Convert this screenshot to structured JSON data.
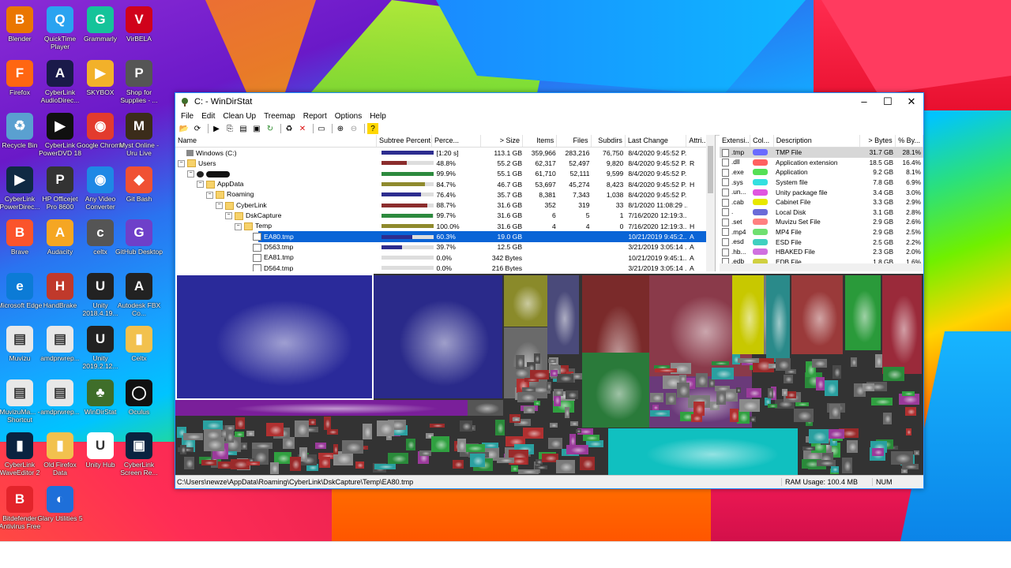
{
  "desktop": {
    "icons": [
      {
        "label": "Blender",
        "glyph": "B",
        "color": "#ea7600"
      },
      {
        "label": "QuickTime Player",
        "glyph": "Q",
        "color": "#2aa3f0"
      },
      {
        "label": "Grammarly",
        "glyph": "G",
        "color": "#15c39a"
      },
      {
        "label": "VirBELA",
        "glyph": "V",
        "color": "#d0021b"
      },
      {
        "label": "Firefox",
        "glyph": "F",
        "color": "#ff6611"
      },
      {
        "label": "CyberLink AudioDirec...",
        "glyph": "A",
        "color": "#1a1a4a"
      },
      {
        "label": "SKYBOX",
        "glyph": "▶",
        "color": "#f2b12a"
      },
      {
        "label": "Shop for Supplies - ...",
        "glyph": "P",
        "color": "#555555"
      },
      {
        "label": "Recycle Bin",
        "glyph": "♻",
        "color": "#5aa0d0"
      },
      {
        "label": "CyberLink PowerDVD 18",
        "glyph": "▶",
        "color": "#101010"
      },
      {
        "label": "Google Chrome",
        "glyph": "◉",
        "color": "#e33b2e"
      },
      {
        "label": "Myst Online - Uru Live",
        "glyph": "M",
        "color": "#3b2c1a"
      },
      {
        "label": "CyberLink PowerDirec...",
        "glyph": "▶",
        "color": "#0f2a44"
      },
      {
        "label": "HP Officejet Pro 8600",
        "glyph": "P",
        "color": "#333333"
      },
      {
        "label": "Any Video Converter",
        "glyph": "◉",
        "color": "#1e88e5"
      },
      {
        "label": "Git Bash",
        "glyph": "◆",
        "color": "#f05133"
      },
      {
        "label": "Brave",
        "glyph": "B",
        "color": "#fb542b"
      },
      {
        "label": "Audacity",
        "glyph": "A",
        "color": "#f5a623"
      },
      {
        "label": "celtx",
        "glyph": "c",
        "color": "#555555"
      },
      {
        "label": "GitHub Desktop",
        "glyph": "G",
        "color": "#6e40c9"
      },
      {
        "label": "Microsoft Edge",
        "glyph": "e",
        "color": "#0c7bd6"
      },
      {
        "label": "HandBrake",
        "glyph": "H",
        "color": "#c0392b"
      },
      {
        "label": "Unity 2018.4.19...",
        "glyph": "U",
        "color": "#222222"
      },
      {
        "label": "Autodesk FBX Co...",
        "glyph": "A",
        "color": "#222222"
      },
      {
        "label": "Muvizu",
        "glyph": "▤",
        "color": "#e8e8e8"
      },
      {
        "label": "amdprwrep...",
        "glyph": "▤",
        "color": "#e8e8e8"
      },
      {
        "label": "Unity 2019.2.12...",
        "glyph": "U",
        "color": "#222222"
      },
      {
        "label": "Celtx",
        "glyph": "▮",
        "color": "#f2c14e"
      },
      {
        "label": "MuvizuMa... - Shortcut",
        "glyph": "▤",
        "color": "#e8e8e8"
      },
      {
        "label": "amdprwrep...",
        "glyph": "▤",
        "color": "#e8e8e8"
      },
      {
        "label": "WinDirStat",
        "glyph": "♣",
        "color": "#3f6e2a"
      },
      {
        "label": "Oculus",
        "glyph": "◯",
        "color": "#111111"
      },
      {
        "label": "CyberLink WaveEditor 2",
        "glyph": "▮",
        "color": "#0a2340"
      },
      {
        "label": "Old Firefox Data",
        "glyph": "▮",
        "color": "#f2c14e"
      },
      {
        "label": "Unity Hub",
        "glyph": "U",
        "color": "#ffffff"
      },
      {
        "label": "CyberLink Screen Re...",
        "glyph": "▣",
        "color": "#0a2340"
      },
      {
        "label": "Bitdefender Antivirus Free",
        "glyph": "B",
        "color": "#e3242b"
      },
      {
        "label": "Glary Utilities 5",
        "glyph": "◐",
        "color": "#1e6fd9"
      }
    ]
  },
  "window": {
    "title": "C: - WinDirStat",
    "minimize": "–",
    "maximize": "☐",
    "close": "✕",
    "menus": [
      "File",
      "Edit",
      "Clean Up",
      "Treemap",
      "Report",
      "Options",
      "Help"
    ]
  },
  "tree": {
    "headers": {
      "name": "Name",
      "subtree": "Subtree Percent...",
      "perc": "Perce...",
      "size": "> Size",
      "items": "Items",
      "files": "Files",
      "subdirs": "Subdirs",
      "last": "Last Change",
      "attr": "Attri..."
    },
    "rows": [
      {
        "name": "Windows (C:)",
        "perc": "[1:20 s]",
        "size": "113.1 GB",
        "items": "359,966",
        "files": "283,216",
        "subdirs": "76,750",
        "last": "8/4/2020  9:45:52 P...",
        "attr": "",
        "bar": 1.0,
        "barColor": "#2d2d8f",
        "depth": 0,
        "icon": "drive",
        "exp": "",
        "sel": false
      },
      {
        "name": "Users",
        "perc": "48.8%",
        "size": "55.2 GB",
        "items": "62,317",
        "files": "52,497",
        "subdirs": "9,820",
        "last": "8/4/2020  9:45:52 P...",
        "attr": "R",
        "bar": 0.49,
        "barColor": "#8b2d2d",
        "depth": 0,
        "icon": "folder",
        "exp": "−",
        "sel": false
      },
      {
        "name": "",
        "perc": "99.9%",
        "size": "55.1 GB",
        "items": "61,710",
        "files": "52,111",
        "subdirs": "9,599",
        "last": "8/4/2020  9:45:52 P...",
        "attr": "",
        "bar": 0.999,
        "barColor": "#2d8a3e",
        "depth": 1,
        "icon": "user",
        "exp": "−",
        "sel": false
      },
      {
        "name": "AppData",
        "perc": "84.7%",
        "size": "46.7 GB",
        "items": "53,697",
        "files": "45,274",
        "subdirs": "8,423",
        "last": "8/4/2020  9:45:52 P...",
        "attr": "H",
        "bar": 0.847,
        "barColor": "#8f8a2d",
        "depth": 2,
        "icon": "folder",
        "exp": "−",
        "sel": false
      },
      {
        "name": "Roaming",
        "perc": "76.4%",
        "size": "35.7 GB",
        "items": "8,381",
        "files": "7,343",
        "subdirs": "1,038",
        "last": "8/4/2020  9:45:52 P...",
        "attr": "",
        "bar": 0.764,
        "barColor": "#2d2d8f",
        "depth": 3,
        "icon": "folder",
        "exp": "−",
        "sel": false
      },
      {
        "name": "CyberLink",
        "perc": "88.7%",
        "size": "31.6 GB",
        "items": "352",
        "files": "319",
        "subdirs": "33",
        "last": "8/1/2020  11:08:29 ...",
        "attr": "",
        "bar": 0.887,
        "barColor": "#8b2d2d",
        "depth": 4,
        "icon": "folder",
        "exp": "−",
        "sel": false
      },
      {
        "name": "DskCapture",
        "perc": "99.7%",
        "size": "31.6 GB",
        "items": "6",
        "files": "5",
        "subdirs": "1",
        "last": "7/16/2020  12:19:3...",
        "attr": "",
        "bar": 0.997,
        "barColor": "#2d8a3e",
        "depth": 5,
        "icon": "folder",
        "exp": "−",
        "sel": false
      },
      {
        "name": "Temp",
        "perc": "100.0%",
        "size": "31.6 GB",
        "items": "4",
        "files": "4",
        "subdirs": "0",
        "last": "7/16/2020  12:19:3...",
        "attr": "H",
        "bar": 1.0,
        "barColor": "#8f8a2d",
        "depth": 6,
        "icon": "folder",
        "exp": "−",
        "sel": false
      },
      {
        "name": "EA80.tmp",
        "perc": "60.3%",
        "size": "19.0 GB",
        "items": "",
        "files": "",
        "subdirs": "",
        "last": "10/21/2019  9:45:2...",
        "attr": "A",
        "bar": 0.603,
        "barColor": "#2d2d8f",
        "depth": 7,
        "icon": "file",
        "exp": "",
        "sel": true
      },
      {
        "name": "D563.tmp",
        "perc": "39.7%",
        "size": "12.5 GB",
        "items": "",
        "files": "",
        "subdirs": "",
        "last": "3/21/2019  3:05:14 ...",
        "attr": "A",
        "bar": 0.397,
        "barColor": "#2d2d8f",
        "depth": 7,
        "icon": "file",
        "exp": "",
        "sel": false
      },
      {
        "name": "EA81.tmp",
        "perc": "0.0%",
        "size": "342 Bytes",
        "items": "",
        "files": "",
        "subdirs": "",
        "last": "10/21/2019  9:45:1...",
        "attr": "A",
        "bar": 0.0,
        "barColor": "#2d2d8f",
        "depth": 7,
        "icon": "file",
        "exp": "",
        "sel": false
      },
      {
        "name": "D564.tmp",
        "perc": "0.0%",
        "size": "216 Bytes",
        "items": "",
        "files": "",
        "subdirs": "",
        "last": "3/21/2019  3:05:14 ...",
        "attr": "A",
        "bar": 0.0,
        "barColor": "#2d2d8f",
        "depth": 7,
        "icon": "file",
        "exp": "",
        "sel": false
      }
    ]
  },
  "ext": {
    "headers": {
      "ext": "Extensi...",
      "col": "Col...",
      "desc": "Description",
      "bytes": "> Bytes",
      "pct": "% By..."
    },
    "rows": [
      {
        "ext": ".tmp",
        "color": "#6b6bff",
        "desc": "TMP File",
        "bytes": "31.7 GB",
        "pct": "28.1%",
        "sel": true
      },
      {
        "ext": ".dll",
        "color": "#ff6060",
        "desc": "Application extension",
        "bytes": "18.5 GB",
        "pct": "16.4%",
        "sel": false
      },
      {
        "ext": ".exe",
        "color": "#55e055",
        "desc": "Application",
        "bytes": "9.2 GB",
        "pct": "8.1%",
        "sel": false
      },
      {
        "ext": ".sys",
        "color": "#33e0e0",
        "desc": "System file",
        "bytes": "7.8 GB",
        "pct": "6.9%",
        "sel": false
      },
      {
        "ext": ".un...",
        "color": "#e055e0",
        "desc": "Unity package file",
        "bytes": "3.4 GB",
        "pct": "3.0%",
        "sel": false
      },
      {
        "ext": ".cab",
        "color": "#e8e800",
        "desc": "Cabinet File",
        "bytes": "3.3 GB",
        "pct": "2.9%",
        "sel": false
      },
      {
        "ext": ".",
        "color": "#6b6bd8",
        "desc": "Local Disk",
        "bytes": "3.1 GB",
        "pct": "2.8%",
        "sel": false
      },
      {
        "ext": ".set",
        "color": "#ff8080",
        "desc": "Muvizu Set File",
        "bytes": "2.9 GB",
        "pct": "2.6%",
        "sel": false
      },
      {
        "ext": ".mp4",
        "color": "#70e070",
        "desc": "MP4 File",
        "bytes": "2.9 GB",
        "pct": "2.5%",
        "sel": false
      },
      {
        "ext": ".esd",
        "color": "#40d0c0",
        "desc": "ESD File",
        "bytes": "2.5 GB",
        "pct": "2.2%",
        "sel": false
      },
      {
        "ext": ".hb...",
        "color": "#d070e0",
        "desc": "HBAKED File",
        "bytes": "2.3 GB",
        "pct": "2.0%",
        "sel": false
      },
      {
        "ext": ".edb",
        "color": "#d0d040",
        "desc": "EDB File",
        "bytes": "1.8 GB",
        "pct": "1.6%",
        "sel": false
      }
    ]
  },
  "status": {
    "path": "C:\\Users\\newze\\AppData\\Roaming\\CyberLink\\DskCapture\\Temp\\EA80.tmp",
    "ram": "RAM Usage:     100.4 MB",
    "num": "NUM"
  }
}
